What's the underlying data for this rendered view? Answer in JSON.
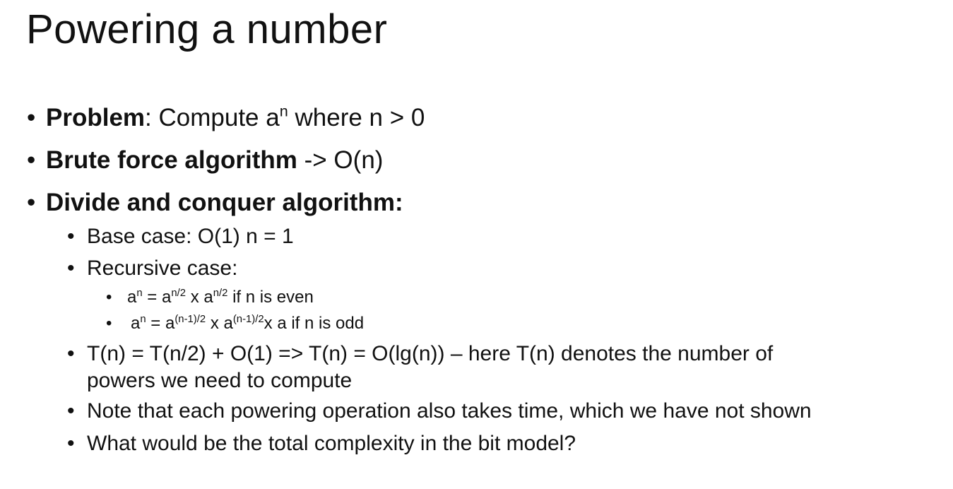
{
  "slide": {
    "title": "Powering a number",
    "bullet_glyph": "•",
    "items": {
      "problem": {
        "label": "Problem",
        "text_a": ": Compute a",
        "sup": "n",
        "text_b": " where n > 0"
      },
      "brute": {
        "label": "Brute force algorithm",
        "text": " -> O(n)"
      },
      "dc": {
        "label": "Divide and conquer algorithm:"
      },
      "base_case": {
        "text": "Base case: O(1) n = 1"
      },
      "recursive_case": {
        "text": "Recursive case:"
      },
      "even": {
        "a1": "a",
        "s1": "n",
        "a2": " = a",
        "s2": "n/2",
        "a3": " x a",
        "s3": "n/2",
        "a4": " if n is even"
      },
      "odd": {
        "a1": "a",
        "s1": "n",
        "a2": " = a",
        "s2": "(n-1)/2",
        "a3": " x a",
        "s3": "(n-1)/2",
        "a4": "x a if n is  odd"
      },
      "recurrence": {
        "line1": "T(n) =  T(n/2) + O(1) => T(n) = O(lg(n)) – here T(n) denotes the number of",
        "line2": "powers we need to compute"
      },
      "note": {
        "text": "Note that each powering operation also takes time, which we have not shown"
      },
      "question": {
        "text": "What would be the total complexity in the bit model?"
      }
    }
  }
}
